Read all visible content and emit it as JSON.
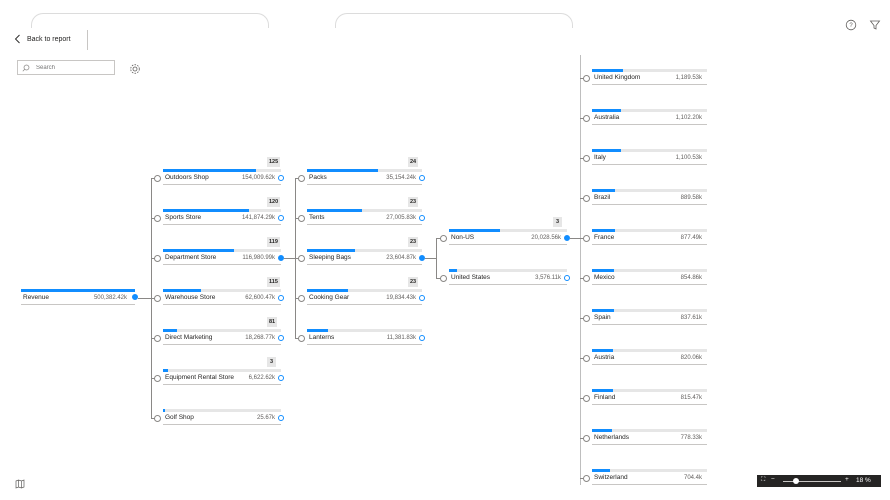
{
  "header": {
    "back_label": "Back to report",
    "search_placeholder": "Search"
  },
  "tree": {
    "root": {
      "label": "Revenue",
      "value": "500,382.42k",
      "fraction": 1.0
    },
    "stores": [
      {
        "label": "Outdoors Shop",
        "value": "154,009.62k",
        "count": "125",
        "fraction": 0.79
      },
      {
        "label": "Sports Store",
        "value": "141,874.29k",
        "count": "120",
        "fraction": 0.73
      },
      {
        "label": "Department Store",
        "value": "116,980.99k",
        "count": "119",
        "fraction": 0.6
      },
      {
        "label": "Warehouse Store",
        "value": "62,600.47k",
        "count": "115",
        "fraction": 0.32
      },
      {
        "label": "Direct Marketing",
        "value": "18,268.77k",
        "count": "81",
        "fraction": 0.12
      },
      {
        "label": "Equipment Rental Store",
        "value": "6,622.62k",
        "count": "3",
        "fraction": 0.04
      },
      {
        "label": "Golf Shop",
        "value": "25.67k",
        "count": "",
        "fraction": 0.005
      }
    ],
    "products": [
      {
        "label": "Packs",
        "value": "35,154.24k",
        "count": "24",
        "fraction": 0.62
      },
      {
        "label": "Tents",
        "value": "27,005.83k",
        "count": "23",
        "fraction": 0.48
      },
      {
        "label": "Sleeping Bags",
        "value": "23,604.87k",
        "count": "23",
        "fraction": 0.42
      },
      {
        "label": "Cooking Gear",
        "value": "19,834.43k",
        "count": "23",
        "fraction": 0.36
      },
      {
        "label": "Lanterns",
        "value": "11,381.83k",
        "count": "",
        "fraction": 0.18
      }
    ],
    "regions": [
      {
        "label": "Non-US",
        "value": "20,028.56k",
        "count": "3",
        "fraction": 0.43
      },
      {
        "label": "United States",
        "value": "3,576.11k",
        "count": "",
        "fraction": 0.07
      }
    ],
    "countries": [
      {
        "label": "United Kingdom",
        "value": "1,189.53k",
        "fraction": 0.27
      },
      {
        "label": "Australia",
        "value": "1,102.20k",
        "fraction": 0.25
      },
      {
        "label": "Italy",
        "value": "1,100.53k",
        "fraction": 0.25
      },
      {
        "label": "Brazil",
        "value": "889.58k",
        "fraction": 0.2
      },
      {
        "label": "France",
        "value": "877.49k",
        "fraction": 0.2
      },
      {
        "label": "Mexico",
        "value": "854.86k",
        "fraction": 0.19
      },
      {
        "label": "Spain",
        "value": "837.61k",
        "fraction": 0.19
      },
      {
        "label": "Austria",
        "value": "820.06k",
        "fraction": 0.18
      },
      {
        "label": "Finland",
        "value": "815.47k",
        "fraction": 0.18
      },
      {
        "label": "Netherlands",
        "value": "778.33k",
        "fraction": 0.17
      },
      {
        "label": "Switzerland",
        "value": "704.4k",
        "fraction": 0.16
      }
    ]
  },
  "zoom": {
    "minus": "−",
    "plus": "+",
    "level": "18 %"
  },
  "colors": {
    "accent": "#118dff",
    "track": "#e6e6e6",
    "text": "#252423"
  }
}
